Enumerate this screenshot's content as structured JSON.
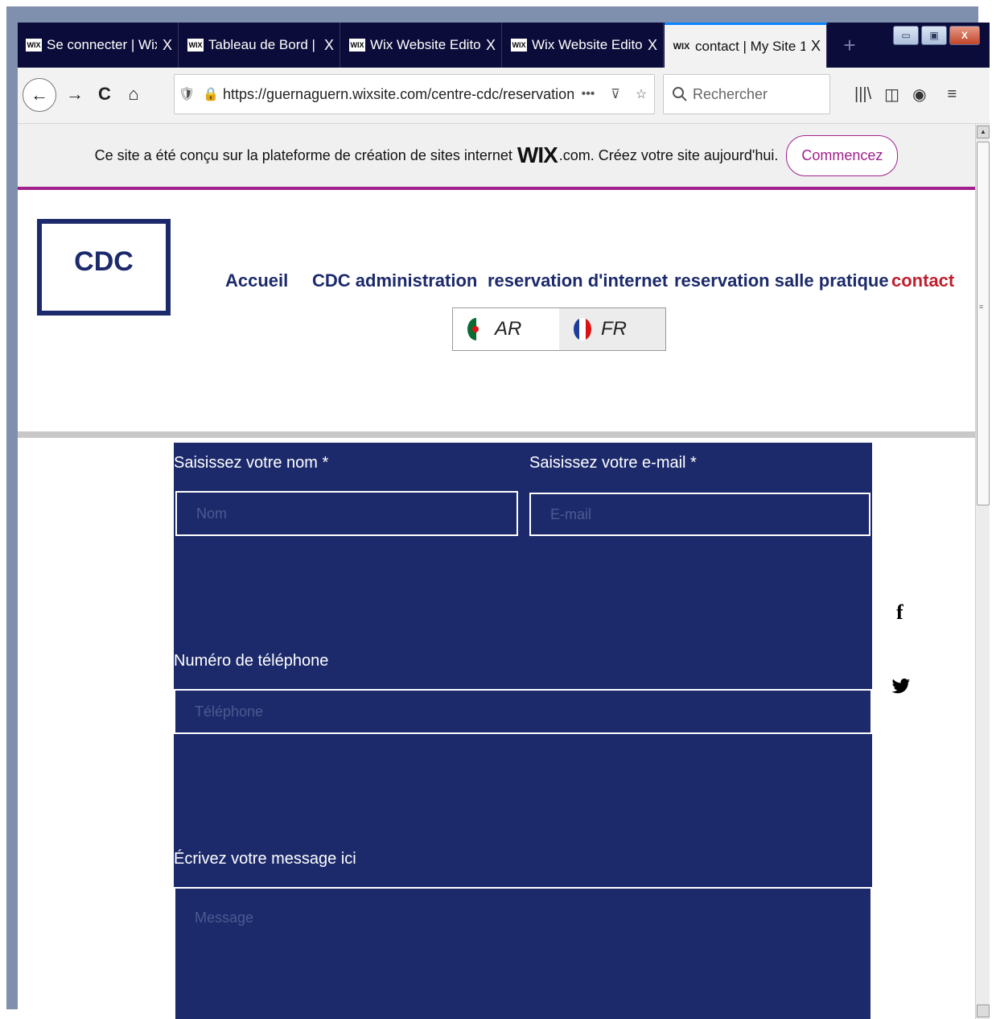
{
  "browser": {
    "tabs": [
      {
        "favicon": "WIX",
        "title": "Se connecter | Wix",
        "close": "X"
      },
      {
        "favicon": "WIX",
        "title": "Tableau de Bord | Wi",
        "close": "X"
      },
      {
        "favicon": "WIX",
        "title": "Wix Website Editor",
        "close": "X"
      },
      {
        "favicon": "WIX",
        "title": "Wix Website Editor",
        "close": "X"
      },
      {
        "favicon": "WIX",
        "title": "contact | My Site 1",
        "close": "X",
        "active": true
      }
    ],
    "new_tab": "+",
    "window_buttons": {
      "minimize": "▭",
      "restore": "▣",
      "close": "X"
    },
    "nav": {
      "back": "←",
      "forward": "→",
      "reload": "C",
      "home": "⌂"
    },
    "url": {
      "shield": "🛡",
      "lock": "🔒",
      "main": "https://guernaguern.wixsite.com/centre-cdc/reservation-sa",
      "more": "•••",
      "pocket": "⊽",
      "star": "☆"
    },
    "search_placeholder": "Rechercher",
    "search_icon": "search-icon",
    "tools": {
      "library": "|||\\",
      "sidebar": "◫",
      "account": "◉",
      "menu": "≡"
    }
  },
  "wix_banner": {
    "text_before": "Ce site a été conçu sur la plateforme de création de sites internet",
    "logo": "WIX",
    "text_after": ".com. Créez votre site aujourd'hui.",
    "button": "Commencez",
    "accent_color": "#a0218c"
  },
  "site": {
    "logo": "CDC",
    "menu": [
      "Accueil",
      "CDC administration",
      "reservation d'internet",
      "reservation salle pratique",
      "contact"
    ],
    "active_menu": "contact",
    "languages": [
      {
        "code": "AR",
        "flag": "flag-algeria-icon"
      },
      {
        "code": "FR",
        "flag": "flag-france-icon",
        "selected": true
      }
    ],
    "brand_color": "#1c2a6b",
    "active_color": "#c0202e"
  },
  "form": {
    "name_label": "Saisissez votre nom *",
    "name_placeholder": "Nom",
    "email_label": "Saisissez votre e-mail *",
    "email_placeholder": "E-mail",
    "phone_label": "Numéro de téléphone",
    "phone_placeholder": "Téléphone",
    "message_label": "Écrivez votre message ici",
    "message_placeholder": "Message"
  },
  "social": {
    "facebook": "f",
    "twitter": "🐦"
  }
}
